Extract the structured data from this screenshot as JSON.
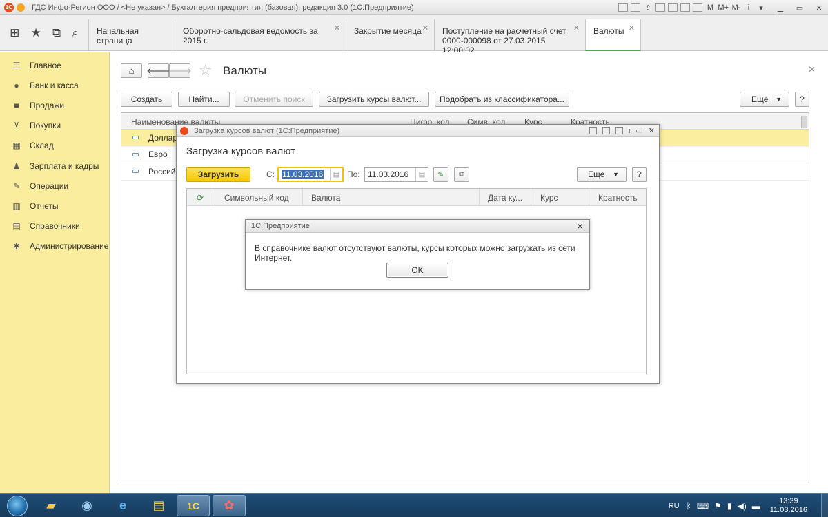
{
  "window": {
    "title": "ГДС Инфо-Регион ООО / <Не указан> / Бухгалтерия предприятия (базовая), редакция 3.0  (1С:Предприятие)",
    "tools": [
      "M",
      "M+",
      "M-"
    ]
  },
  "tabs": [
    {
      "label": "Начальная страница",
      "closable": false
    },
    {
      "label": "Оборотно-сальдовая ведомость за 2015 г.",
      "closable": true
    },
    {
      "label": "Закрытие месяца",
      "closable": true
    },
    {
      "label": "Поступление на расчетный счет 0000-000098 от 27.03.2015 12:00:02",
      "closable": true
    },
    {
      "label": "Валюты",
      "closable": true,
      "active": true
    }
  ],
  "sidebar": {
    "items": [
      {
        "label": "Главное",
        "icon": "menu-icon"
      },
      {
        "label": "Банк и касса",
        "icon": "bank-icon"
      },
      {
        "label": "Продажи",
        "icon": "sales-icon"
      },
      {
        "label": "Покупки",
        "icon": "cart-icon"
      },
      {
        "label": "Склад",
        "icon": "warehouse-icon"
      },
      {
        "label": "Зарплата и кадры",
        "icon": "people-icon"
      },
      {
        "label": "Операции",
        "icon": "operations-icon"
      },
      {
        "label": "Отчеты",
        "icon": "chart-icon"
      },
      {
        "label": "Справочники",
        "icon": "book-icon"
      },
      {
        "label": "Администрирование",
        "icon": "gear-icon"
      }
    ]
  },
  "page": {
    "title": "Валюты",
    "buttons": {
      "create": "Создать",
      "find": "Найти...",
      "cancel_search": "Отменить поиск",
      "load_rates": "Загрузить курсы валют...",
      "pick_classifier": "Подобрать из классификатора...",
      "more": "Еще",
      "help": "?"
    },
    "columns": [
      "Наименование валюты",
      "Цифр. код",
      "Симв. код",
      "Курс",
      "Кратность"
    ],
    "rows": [
      {
        "name": "Доллар",
        "selected": true
      },
      {
        "name": "Евро",
        "selected": false
      },
      {
        "name": "Россий",
        "selected": false
      }
    ]
  },
  "dialog": {
    "title": "Загрузка курсов валют  (1С:Предприятие)",
    "heading": "Загрузка курсов валют",
    "load_button": "Загрузить",
    "from_label": "С:",
    "from_value": "11.03.2016",
    "to_label": "По:",
    "to_value": "11.03.2016",
    "more": "Еще",
    "help": "?",
    "columns": [
      "Символьный код",
      "Валюта",
      "Дата ку...",
      "Курс",
      "Кратность"
    ]
  },
  "message": {
    "title": "1С:Предприятие",
    "text": "В справочнике валют отсутствуют валюты, курсы которых можно загружать из сети Интернет.",
    "ok": "OK"
  },
  "taskbar": {
    "lang": "RU",
    "time": "13:39",
    "date": "11.03.2016"
  }
}
